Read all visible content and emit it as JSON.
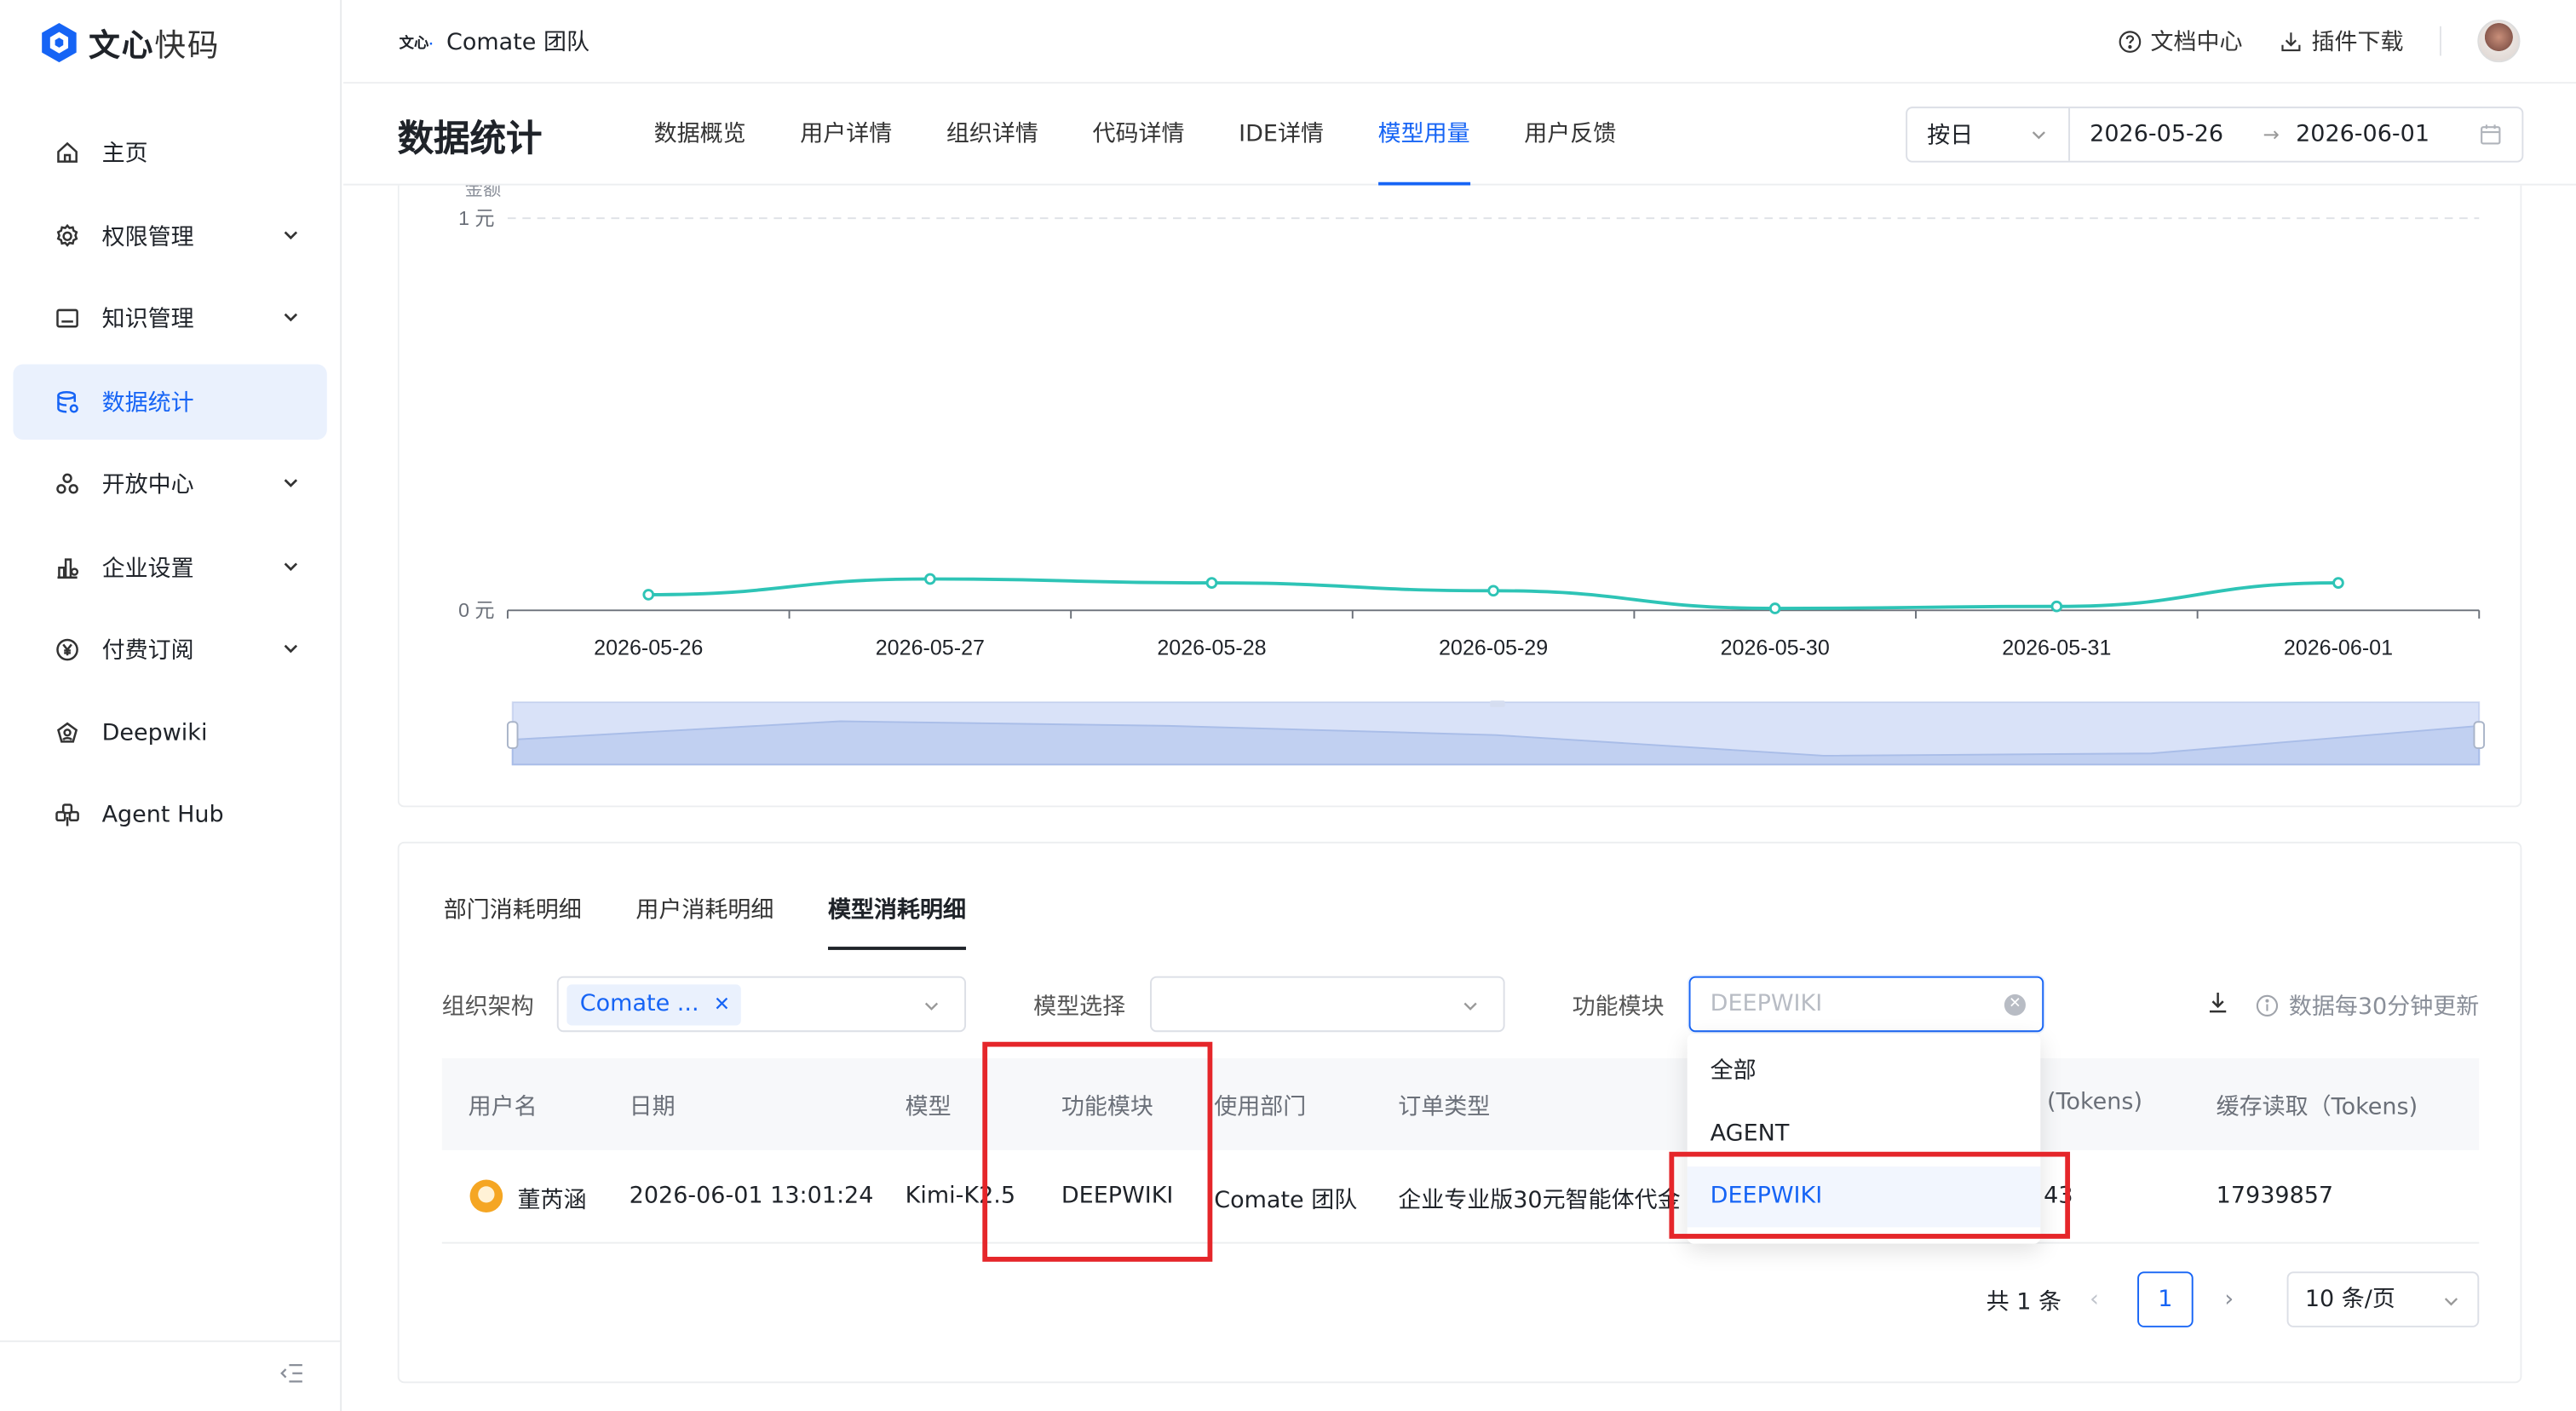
{
  "app": {
    "logo_text_bold": "文心",
    "logo_text_thin": "快码"
  },
  "sidebar": {
    "items": [
      {
        "label": "主页",
        "icon": "home-icon",
        "has_chevron": false,
        "active": false
      },
      {
        "label": "权限管理",
        "icon": "gear-icon",
        "has_chevron": true,
        "active": false
      },
      {
        "label": "知识管理",
        "icon": "book-icon",
        "has_chevron": true,
        "active": false
      },
      {
        "label": "数据统计",
        "icon": "database-icon",
        "has_chevron": false,
        "active": true
      },
      {
        "label": "开放中心",
        "icon": "apps-icon",
        "has_chevron": true,
        "active": false
      },
      {
        "label": "企业设置",
        "icon": "enterprise-icon",
        "has_chevron": true,
        "active": false
      },
      {
        "label": "付费订阅",
        "icon": "yen-icon",
        "has_chevron": true,
        "active": false
      },
      {
        "label": "Deepwiki",
        "icon": "deepwiki-icon",
        "has_chevron": false,
        "active": false
      },
      {
        "label": "Agent Hub",
        "icon": "hub-icon",
        "has_chevron": false,
        "active": false
      }
    ]
  },
  "header": {
    "team_logo": "文心",
    "team_name": "Comate 团队",
    "doc_center": "文档中心",
    "plugin_download": "插件下载"
  },
  "subheader": {
    "title": "数据统计",
    "tabs": [
      "数据概览",
      "用户详情",
      "组织详情",
      "代码详情",
      "IDE详情",
      "模型用量",
      "用户反馈"
    ],
    "active_tab": "模型用量",
    "date_unit": "按日",
    "date_start": "2026-05-26",
    "date_end": "2026-06-01"
  },
  "chart_data": {
    "type": "line",
    "ylabel": "金额",
    "y_ticks": [
      "1 元",
      "0 元"
    ],
    "ylim": [
      0,
      1
    ],
    "x": [
      "2026-05-26",
      "2026-05-27",
      "2026-05-28",
      "2026-05-29",
      "2026-05-30",
      "2026-05-31",
      "2026-06-01"
    ],
    "series": [
      {
        "values": [
          0.04,
          0.08,
          0.07,
          0.05,
          0.005,
          0.01,
          0.07
        ],
        "color": "#2ec4b6"
      }
    ],
    "grid": true
  },
  "detail": {
    "tabs": [
      "部门消耗明细",
      "用户消耗明细",
      "模型消耗明细"
    ],
    "active_tab": "模型消耗明细",
    "filters": {
      "org_label": "组织架构",
      "org_tag": "Comate ...",
      "model_label": "模型选择",
      "feature_label": "功能模块",
      "feature_placeholder": "DEEPWIKI",
      "update_note": "数据每30分钟更新"
    },
    "columns": [
      "用户名",
      "日期",
      "模型",
      "功能模块",
      "使用部门",
      "订单类型",
      "(Tokens)",
      "缓存读取（Tokens)"
    ],
    "rows": [
      {
        "user": "董芮涵",
        "date": "2026-06-01 13:01:24",
        "model": "Kimi-K2.5",
        "feature": "DEEPWIKI",
        "department": "Comate 团队",
        "order_type": "企业专业版30元智能体代金",
        "tokens": "43",
        "cache_read": "17939857"
      }
    ],
    "pagination": {
      "total": "共 1 条",
      "current": "1",
      "page_size": "10 条/页"
    }
  },
  "dropdown": {
    "options": [
      "全部",
      "AGENT",
      "DEEPWIKI"
    ],
    "selected": "DEEPWIKI"
  },
  "colors": {
    "accent": "#1664f5",
    "line": "#2ec4b6",
    "annotation": "#e5262a"
  }
}
